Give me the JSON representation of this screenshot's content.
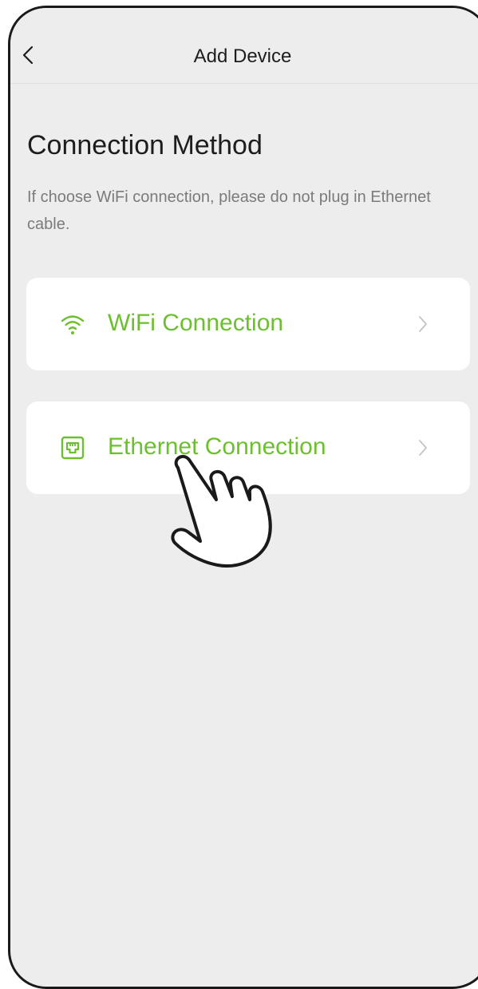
{
  "header": {
    "title": "Add Device"
  },
  "page": {
    "heading": "Connection Method",
    "hint": "If choose WiFi connection, please do not plug in Ethernet cable."
  },
  "options": [
    {
      "label": "WiFi Connection",
      "icon": "wifi-icon"
    },
    {
      "label": "Ethernet Connection",
      "icon": "ethernet-port-icon"
    }
  ],
  "colors": {
    "accent": "#6cbf2f",
    "background": "#ededed",
    "card": "#ffffff",
    "text": "#1d1d1f",
    "hint": "#7b7b7b"
  }
}
